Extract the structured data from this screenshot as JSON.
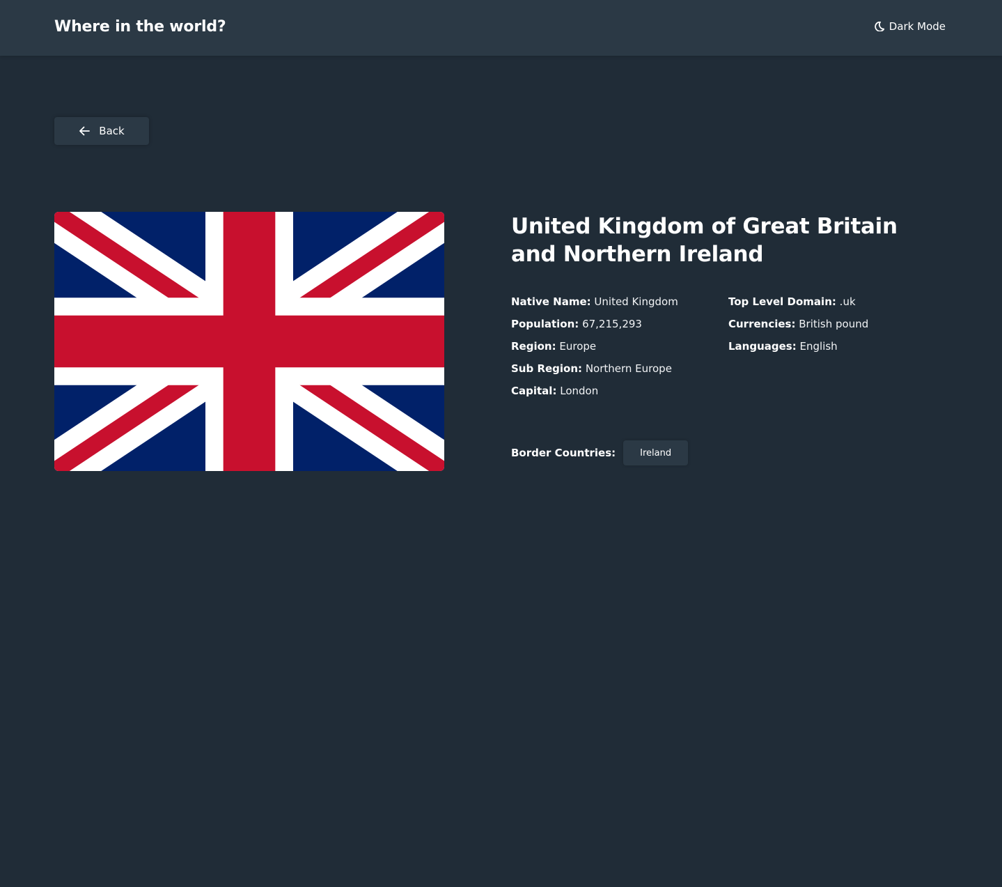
{
  "header": {
    "app_title": "Where in the world?",
    "theme_toggle_label": "Dark Mode",
    "theme_toggle_icon": "moon-icon"
  },
  "back_button": {
    "label": "Back",
    "icon": "arrow-left-icon"
  },
  "country": {
    "name": "United Kingdom of Great Britain and Northern Ireland",
    "flag_icon": "union-jack-flag",
    "details_left": [
      {
        "label": "Native Name:",
        "value": "United Kingdom"
      },
      {
        "label": "Population:",
        "value": "67,215,293"
      },
      {
        "label": "Region:",
        "value": "Europe"
      },
      {
        "label": "Sub Region:",
        "value": "Northern Europe"
      },
      {
        "label": "Capital:",
        "value": "London"
      }
    ],
    "details_right": [
      {
        "label": "Top Level Domain:",
        "value": ".uk"
      },
      {
        "label": "Currencies:",
        "value": "British pound"
      },
      {
        "label": "Languages:",
        "value": "English"
      }
    ],
    "border_countries_label": "Border Countries:",
    "border_countries": [
      "Ireland"
    ]
  },
  "colors": {
    "background": "#202c37",
    "elements": "#2b3945",
    "text": "#ffffff",
    "flag_blue": "#012169",
    "flag_red": "#c8102e"
  }
}
